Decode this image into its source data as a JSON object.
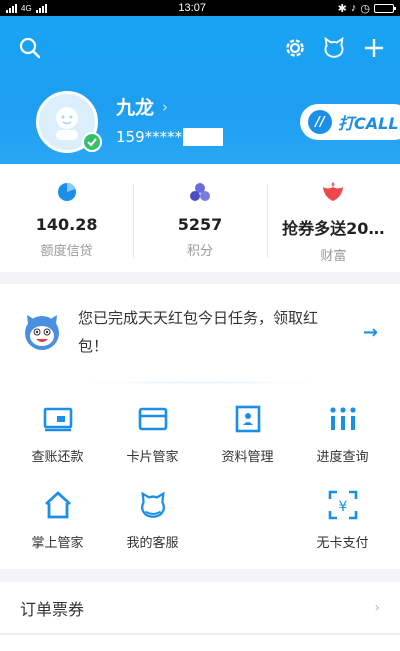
{
  "status_bar": {
    "time": "13:07",
    "network_left": "4G"
  },
  "header": {
    "icons": [
      "search-icon",
      "settings-icon",
      "customer-service-icon",
      "add-icon"
    ],
    "username": "九龙",
    "phone_masked": "159*****",
    "dacall_label": "打CALL",
    "colors": {
      "header_bg": "#1d9ef1",
      "accent": "#1b8fe8"
    }
  },
  "stats": [
    {
      "value": "140.28",
      "label": "额度信贷",
      "icon": "pie-icon"
    },
    {
      "value": "5257",
      "label": "积分",
      "icon": "points-icon"
    },
    {
      "value": "抢券多送20…",
      "label": "财富",
      "icon": "wealth-icon"
    }
  ],
  "notice": {
    "text": "您已完成天天红包今日任务，领取红包！",
    "arrow": "→"
  },
  "services": [
    {
      "label": "查账还款",
      "icon": "bill-icon"
    },
    {
      "label": "卡片管家",
      "icon": "card-icon"
    },
    {
      "label": "资料管理",
      "icon": "profile-icon"
    },
    {
      "label": "进度查询",
      "icon": "progress-icon"
    },
    {
      "label": "掌上管家",
      "icon": "home-icon"
    },
    {
      "label": "我的客服",
      "icon": "service-icon"
    },
    {
      "label": "",
      "icon": ""
    },
    {
      "label": "无卡支付",
      "icon": "cardless-pay-icon"
    }
  ],
  "orders": {
    "label": "订单票券",
    "chevron": "›"
  }
}
